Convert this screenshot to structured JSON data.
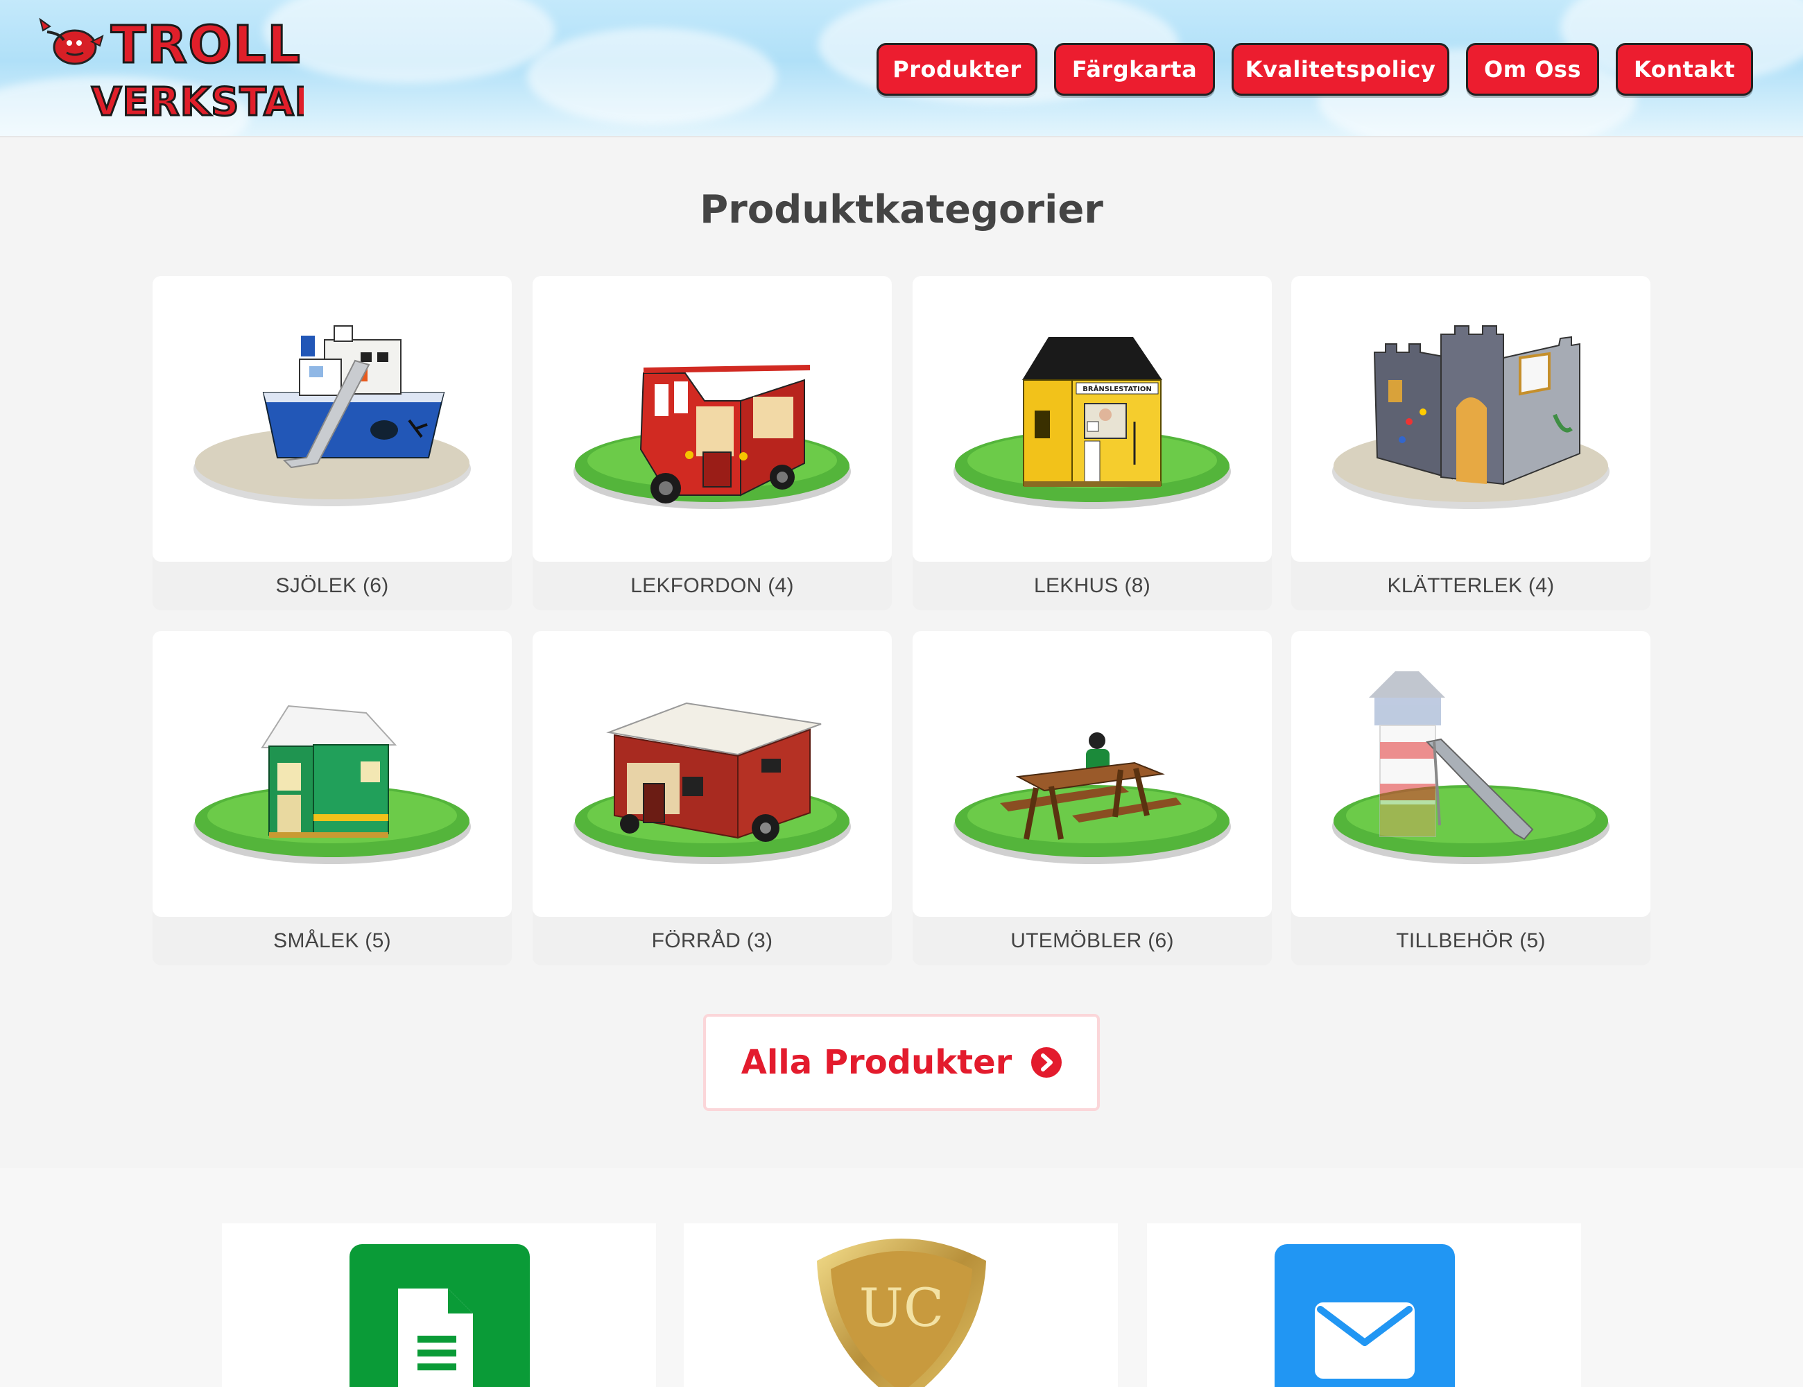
{
  "header": {
    "logo_alt": "Trollverkstan",
    "nav": [
      {
        "label": "Produkter"
      },
      {
        "label": "Färgkarta"
      },
      {
        "label": "Kvalitetspolicy"
      },
      {
        "label": "Om Oss"
      },
      {
        "label": "Kontakt"
      }
    ]
  },
  "main": {
    "title": "Produktkategorier",
    "categories": [
      {
        "label": "SJÖLEK (6)"
      },
      {
        "label": "LEKFORDON (4)"
      },
      {
        "label": "LEKHUS (8)"
      },
      {
        "label": "KLÄTTERLEK (4)"
      },
      {
        "label": "SMÅLEK (5)"
      },
      {
        "label": "FÖRRÅD (3)"
      },
      {
        "label": "UTEMÖBLER (6)"
      },
      {
        "label": "TILLBEHÖR (5)"
      }
    ],
    "all_products_label": "Alla Produkter",
    "bransle_sign": "BRÄNSLESTATION"
  },
  "features": [
    {
      "icon": "document-icon",
      "color": "#0a9b37"
    },
    {
      "icon": "uc-badge-icon",
      "badge_text": "UC"
    },
    {
      "icon": "mail-icon",
      "color": "#2196f3"
    }
  ],
  "colors": {
    "accent_red": "#ec1d2f",
    "title_gray": "#444444"
  }
}
